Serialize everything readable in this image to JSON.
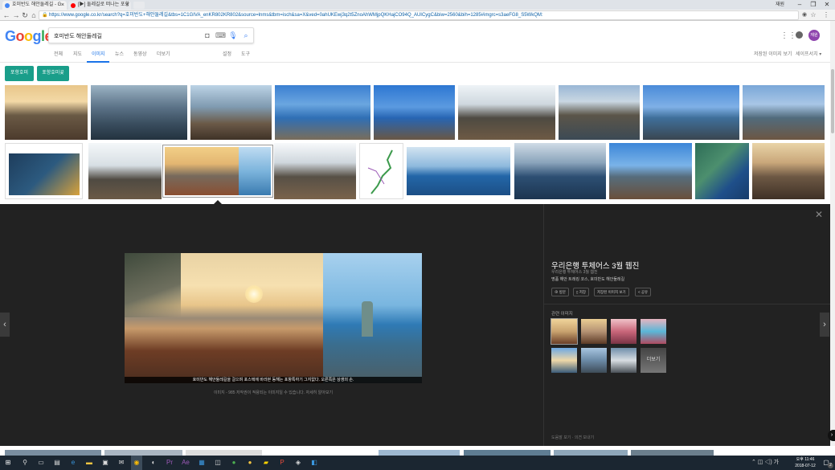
{
  "browser": {
    "tabs": [
      {
        "title": "호미반도 해안둘레길 - G",
        "favicon_color": "#4285f4",
        "active": true
      },
      {
        "title": "[▶] 둘레길로 떠나는 포항",
        "favicon_color": "#ff0000",
        "active": false
      }
    ],
    "user_label": "재원",
    "window_controls": {
      "minimize": "–",
      "restore": "❐",
      "close": "✕"
    },
    "url": "https://www.google.co.kr/search?q=호미반도+해안둘레길&tbs=1C1GIVA_enKR802KR802&source=lnms&tbm=isch&sa=X&ved=0ahUKEwj3q2t5ZnoAhWMjpQKHajCO94Q_AUICygC&biw=2560&bih=1285#imgrc=s3aeFG8_S5WkQM:"
  },
  "google": {
    "logo_letters": [
      {
        "ch": "G",
        "color": "#4285f4"
      },
      {
        "ch": "o",
        "color": "#ea4335"
      },
      {
        "ch": "o",
        "color": "#fbbc05"
      },
      {
        "ch": "g",
        "color": "#4285f4"
      },
      {
        "ch": "l",
        "color": "#34a853"
      },
      {
        "ch": "e",
        "color": "#ea4335"
      }
    ],
    "search_query": "호미반도 해안둘레길",
    "avatar_label": "재원",
    "nav_tabs": [
      {
        "label": "전체",
        "active": false
      },
      {
        "label": "지도",
        "active": false
      },
      {
        "label": "이미지",
        "active": true
      },
      {
        "label": "뉴스",
        "active": false
      },
      {
        "label": "동영상",
        "active": false
      },
      {
        "label": "더보기",
        "active": false
      }
    ],
    "settings_label": "설정",
    "tools_label": "도구",
    "saved_images_label": "저장된 이미지 보기",
    "safesearch_label": "세이프서치 ▾",
    "chips": [
      "포항호미",
      "포항호미곶"
    ]
  },
  "viewer": {
    "title": "우리은행 투체어스 3월 웹진",
    "subtitle": "우리은행 투체어스 3월 웹진",
    "description": "명품 해안 트레킹 코스, 호미반도 해안둘레길",
    "buttons": [
      "방문",
      "저장",
      "저장된 이미지 보기",
      "공유"
    ],
    "image_caption": "호미반도 해안둘레길을 걸으며 포스텍에 바라본 동해는 포항특하기 그지없다. 오른쪽은 상생의 손.",
    "image_size_label": "이미지 - 985",
    "copyright_notice": "저작권이 적용되는 이미지일 수 있습니다.",
    "learn_more": "자세히 알아보기",
    "related_label": "관련 이미지",
    "more_label": "더보기",
    "footer_links": "도움말 보기 · 의견 보내기"
  },
  "taskbar": {
    "time": "오후 11:46",
    "date": "2018-07-12",
    "notification_count": "2"
  }
}
